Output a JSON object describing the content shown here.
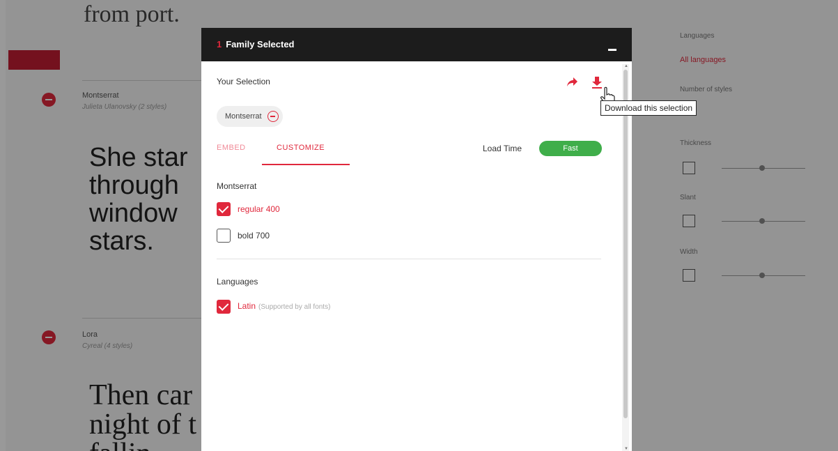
{
  "background": {
    "top_text": "from port.",
    "families": [
      {
        "name": "Montserrat",
        "subtitle": "Julieta Ulanovsky (2 styles)"
      },
      {
        "name": "Lora",
        "subtitle": "Cyreal (4 styles)"
      }
    ],
    "samples": [
      [
        "She star",
        "through",
        "window",
        "stars."
      ],
      [
        "Then car",
        "night of t",
        "fallin"
      ]
    ],
    "sidebar": {
      "languages_label": "Languages",
      "languages_value": "All languages",
      "styles_label": "Number of styles",
      "thickness_label": "Thickness",
      "slant_label": "Slant",
      "width_label": "Width"
    }
  },
  "modal": {
    "count": "1",
    "title": "Family Selected",
    "your_selection": "Your Selection",
    "chip_label": "Montserrat",
    "tabs": {
      "embed": "EMBED",
      "customize": "CUSTOMIZE"
    },
    "load_time_label": "Load Time",
    "load_time_value": "Fast",
    "family_section": "Montserrat",
    "styles": [
      {
        "label": "regular 400",
        "checked": true
      },
      {
        "label": "bold 700",
        "checked": false
      }
    ],
    "languages_section": "Languages",
    "languages": [
      {
        "label": "Latin",
        "note": "(Supported by all fonts)",
        "checked": true
      }
    ]
  },
  "tooltip": "Download this selection",
  "icons": {
    "share": "share-icon",
    "download": "download-icon",
    "cursor": "hand-cursor-icon",
    "remove": "remove-circle-icon",
    "minimize": "minimize-icon"
  },
  "colors": {
    "accent": "#e0283c",
    "header": "#1c1c1c",
    "fast": "#3fae4a"
  }
}
